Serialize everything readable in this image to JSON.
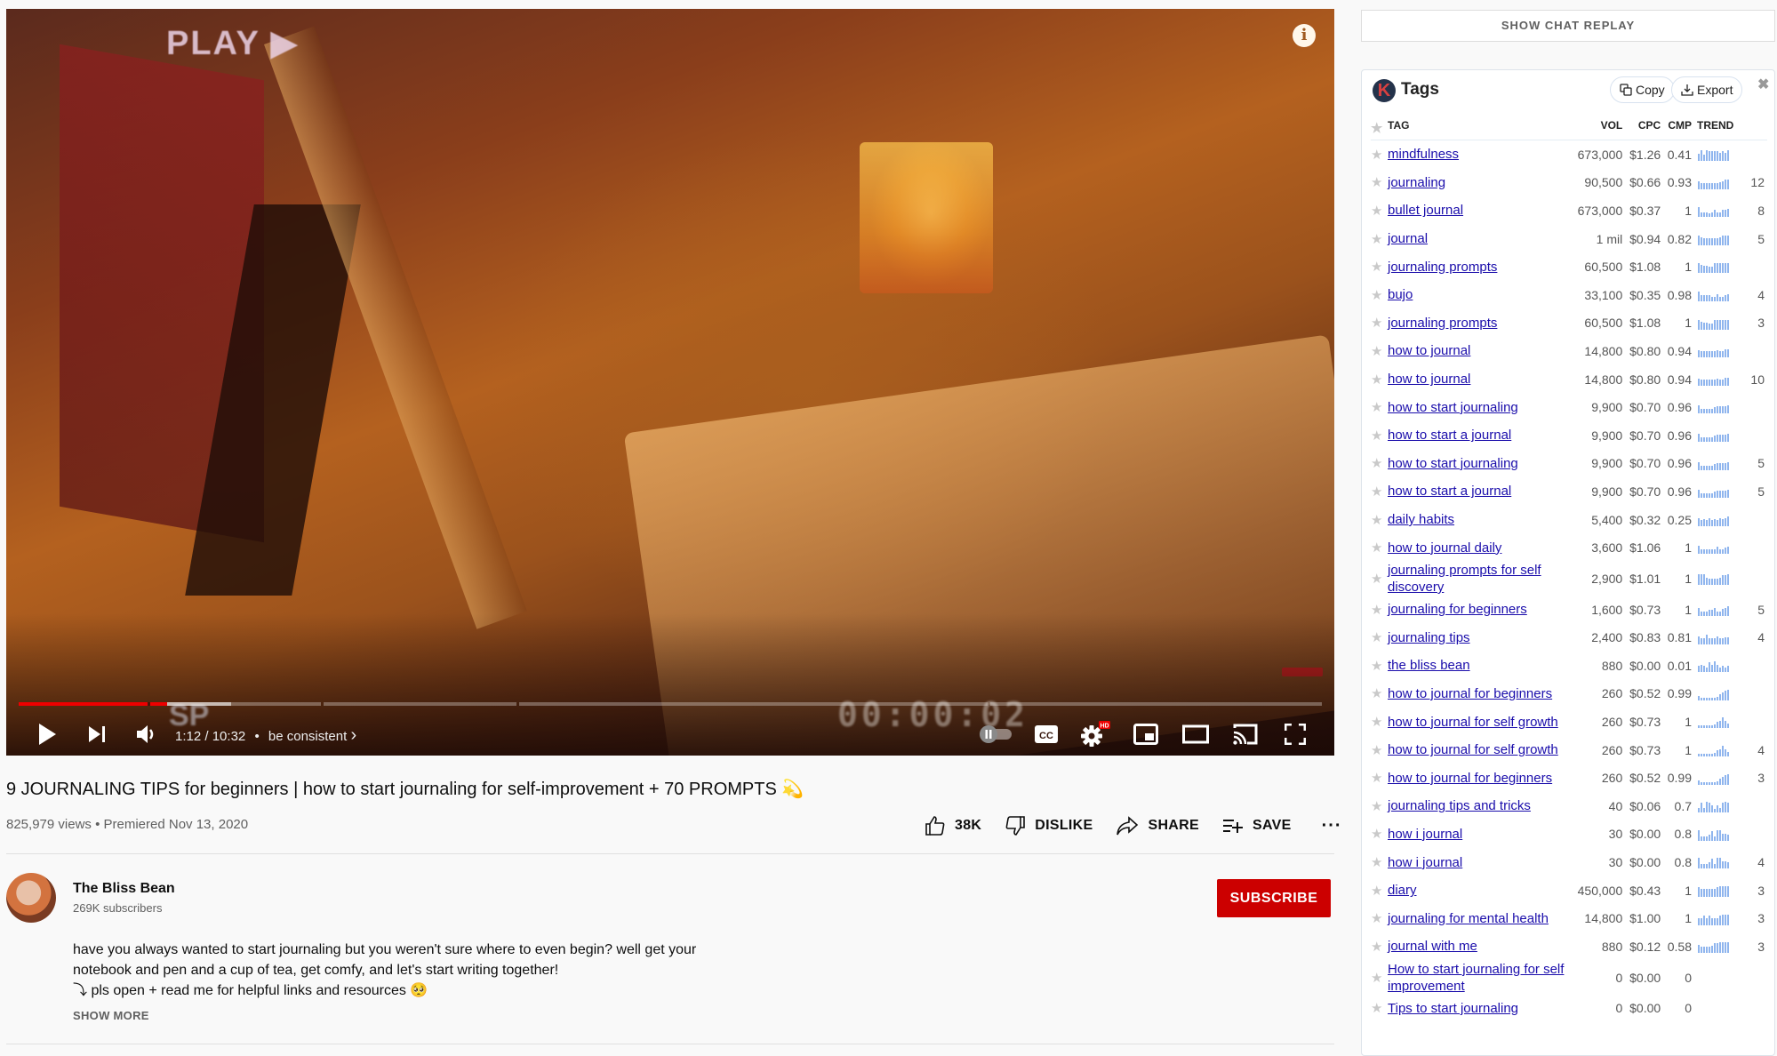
{
  "video": {
    "overlay_text": "PLAY ▶",
    "timecode_overlay": "00:00:02",
    "sp_overlay": "SP",
    "info_icon": "info-icon",
    "progress": {
      "played_fraction": 0.114,
      "loaded_fraction": 0.163
    },
    "current_time": "1:12",
    "duration": "10:32",
    "time_separator": "/",
    "chapter_dot": "•",
    "chapter": "be consistent",
    "chapter_chevron": "›",
    "settings_badge": "HD",
    "cc_label": "CC",
    "icons": [
      "play-icon",
      "next-icon",
      "volume-icon",
      "autoplay-toggle",
      "cc-icon",
      "settings-icon",
      "miniplayer-icon",
      "theater-icon",
      "cast-icon",
      "fullscreen-icon"
    ]
  },
  "title": "9 JOURNALING TIPS for beginners | how to start journaling for self-improvement + 70 PROMPTS 💫",
  "views": "825,979 views",
  "meta_dot": "•",
  "premiered": "Premiered Nov 13, 2020",
  "actions": {
    "like": "38K",
    "dislike": "DISLIKE",
    "share": "SHARE",
    "save": "SAVE",
    "more": "···"
  },
  "channel": {
    "name": "The Bliss Bean",
    "subscribers": "269K subscribers",
    "subscribe": "SUBSCRIBE"
  },
  "description": {
    "line1": "have you always wanted to start journaling but you weren't sure where to even begin? well get your notebook and pen and a cup of tea, get comfy, and let's start writing together!",
    "line2": "⤵ pls open + read me for helpful links and resources 🥺",
    "show_more": "SHOW MORE"
  },
  "chat_replay": "SHOW CHAT REPLAY",
  "tags_panel": {
    "logo": "K",
    "title": "Tags",
    "copy": "Copy",
    "export": "Export",
    "close": "✖",
    "columns": {
      "star": "★",
      "tag": "TAG",
      "vol": "VOL",
      "cpc": "CPC",
      "cmp": "CMP",
      "trend": "TREND"
    },
    "rows": [
      {
        "tag": "mindfulness",
        "vol": "673,000",
        "cpc": "$1.26",
        "cmp": "0.41",
        "trend": [
          6,
          9,
          5,
          9,
          8,
          8,
          8,
          8,
          7,
          8,
          7,
          9
        ],
        "extra": ""
      },
      {
        "tag": "journaling",
        "vol": "90,500",
        "cpc": "$0.66",
        "cmp": "0.93",
        "trend": [
          7,
          5,
          5,
          5,
          5,
          5,
          5,
          5,
          6,
          7,
          8,
          8
        ],
        "extra": "12"
      },
      {
        "tag": "bullet journal",
        "vol": "673,000",
        "cpc": "$0.37",
        "cmp": "1",
        "trend": [
          8,
          4,
          4,
          4,
          3,
          4,
          6,
          4,
          4,
          6,
          6,
          7
        ],
        "extra": "8"
      },
      {
        "tag": "journal",
        "vol": "1 mil",
        "cpc": "$0.94",
        "cmp": "0.82",
        "trend": [
          8,
          7,
          6,
          6,
          6,
          6,
          6,
          6,
          7,
          8,
          8,
          8
        ],
        "extra": "5"
      },
      {
        "tag": "journaling prompts",
        "vol": "60,500",
        "cpc": "$1.08",
        "cmp": "1",
        "trend": [
          8,
          7,
          6,
          6,
          5,
          5,
          8,
          8,
          8,
          8,
          8,
          8
        ],
        "extra": ""
      },
      {
        "tag": "bujo",
        "vol": "33,100",
        "cpc": "$0.35",
        "cmp": "0.98",
        "trend": [
          8,
          5,
          5,
          5,
          5,
          4,
          4,
          6,
          4,
          4,
          5,
          6
        ],
        "extra": "4"
      },
      {
        "tag": "journaling prompts",
        "vol": "60,500",
        "cpc": "$1.08",
        "cmp": "1",
        "trend": [
          8,
          7,
          6,
          6,
          5,
          5,
          8,
          8,
          8,
          8,
          8,
          8
        ],
        "extra": "3"
      },
      {
        "tag": "how to journal",
        "vol": "14,800",
        "cpc": "$0.80",
        "cmp": "0.94",
        "trend": [
          6,
          5,
          5,
          5,
          5,
          5,
          5,
          6,
          5,
          5,
          7,
          7
        ],
        "extra": ""
      },
      {
        "tag": "how to journal",
        "vol": "14,800",
        "cpc": "$0.80",
        "cmp": "0.94",
        "trend": [
          6,
          5,
          5,
          5,
          5,
          5,
          5,
          6,
          5,
          5,
          7,
          7
        ],
        "extra": "10"
      },
      {
        "tag": "how to start journaling",
        "vol": "9,900",
        "cpc": "$0.70",
        "cmp": "0.96",
        "trend": [
          7,
          4,
          4,
          4,
          4,
          4,
          5,
          6,
          6,
          6,
          6,
          7
        ],
        "extra": ""
      },
      {
        "tag": "how to start a journal",
        "vol": "9,900",
        "cpc": "$0.70",
        "cmp": "0.96",
        "trend": [
          7,
          4,
          4,
          4,
          4,
          4,
          5,
          6,
          6,
          6,
          6,
          7
        ],
        "extra": ""
      },
      {
        "tag": "how to start journaling",
        "vol": "9,900",
        "cpc": "$0.70",
        "cmp": "0.96",
        "trend": [
          7,
          4,
          4,
          4,
          4,
          4,
          5,
          6,
          6,
          6,
          6,
          7
        ],
        "extra": "5"
      },
      {
        "tag": "how to start a journal",
        "vol": "9,900",
        "cpc": "$0.70",
        "cmp": "0.96",
        "trend": [
          7,
          4,
          4,
          4,
          4,
          4,
          5,
          6,
          6,
          6,
          6,
          7
        ],
        "extra": "5"
      },
      {
        "tag": "daily habits",
        "vol": "5,400",
        "cpc": "$0.32",
        "cmp": "0.25",
        "trend": [
          7,
          5,
          6,
          5,
          7,
          5,
          6,
          5,
          7,
          6,
          7,
          8
        ],
        "extra": ""
      },
      {
        "tag": "how to journal daily",
        "vol": "3,600",
        "cpc": "$1.06",
        "cmp": "1",
        "trend": [
          7,
          4,
          4,
          4,
          4,
          4,
          4,
          6,
          4,
          4,
          5,
          6
        ],
        "extra": ""
      },
      {
        "tag": "journaling prompts for self discovery",
        "vol": "2,900",
        "cpc": "$1.01",
        "cmp": "1",
        "trend": [
          9,
          9,
          9,
          6,
          5,
          5,
          5,
          5,
          6,
          8,
          8,
          9
        ],
        "extra": ""
      },
      {
        "tag": "journaling for beginners",
        "vol": "1,600",
        "cpc": "$0.73",
        "cmp": "1",
        "trend": [
          7,
          4,
          4,
          4,
          5,
          5,
          7,
          4,
          4,
          6,
          7,
          8
        ],
        "extra": "5"
      },
      {
        "tag": "journaling tips",
        "vol": "2,400",
        "cpc": "$0.83",
        "cmp": "0.81",
        "trend": [
          7,
          5,
          5,
          8,
          5,
          5,
          5,
          7,
          5,
          5,
          6,
          6
        ],
        "extra": "4"
      },
      {
        "tag": "the bliss bean",
        "vol": "880",
        "cpc": "$0.00",
        "cmp": "0.01",
        "trend": [
          5,
          6,
          5,
          4,
          8,
          6,
          9,
          6,
          4,
          5,
          4,
          5
        ],
        "extra": ""
      },
      {
        "tag": "how to journal for beginners",
        "vol": "260",
        "cpc": "$0.52",
        "cmp": "0.99",
        "trend": [
          4,
          2,
          2,
          2,
          2,
          2,
          2,
          3,
          5,
          7,
          8,
          9
        ],
        "extra": ""
      },
      {
        "tag": "how to journal for self growth",
        "vol": "260",
        "cpc": "$0.73",
        "cmp": "1",
        "trend": [
          2,
          2,
          2,
          2,
          2,
          2,
          3,
          5,
          6,
          9,
          6,
          4
        ],
        "extra": ""
      },
      {
        "tag": "how to journal for self growth",
        "vol": "260",
        "cpc": "$0.73",
        "cmp": "1",
        "trend": [
          2,
          2,
          2,
          2,
          2,
          2,
          3,
          5,
          6,
          9,
          6,
          4
        ],
        "extra": "4"
      },
      {
        "tag": "how to journal for beginners",
        "vol": "260",
        "cpc": "$0.52",
        "cmp": "0.99",
        "trend": [
          4,
          2,
          2,
          2,
          2,
          2,
          2,
          3,
          5,
          7,
          8,
          9
        ],
        "extra": "3"
      },
      {
        "tag": "journaling tips and tricks",
        "vol": "40",
        "cpc": "$0.06",
        "cmp": "0.7",
        "trend": [
          4,
          8,
          4,
          9,
          8,
          6,
          3,
          6,
          4,
          8,
          9,
          8
        ],
        "extra": ""
      },
      {
        "tag": "how i journal",
        "vol": "30",
        "cpc": "$0.00",
        "cmp": "0.8",
        "trend": [
          9,
          4,
          4,
          4,
          5,
          8,
          4,
          9,
          9,
          6,
          6,
          5
        ],
        "extra": ""
      },
      {
        "tag": "how i journal",
        "vol": "30",
        "cpc": "$0.00",
        "cmp": "0.8",
        "trend": [
          9,
          4,
          4,
          4,
          5,
          8,
          4,
          9,
          9,
          6,
          6,
          5
        ],
        "extra": "4"
      },
      {
        "tag": "diary",
        "vol": "450,000",
        "cpc": "$0.43",
        "cmp": "1",
        "trend": [
          8,
          7,
          7,
          7,
          7,
          7,
          7,
          8,
          9,
          9,
          9,
          9
        ],
        "extra": "3"
      },
      {
        "tag": "journaling for mental health",
        "vol": "14,800",
        "cpc": "$1.00",
        "cmp": "1",
        "trend": [
          6,
          6,
          8,
          6,
          8,
          6,
          6,
          6,
          8,
          9,
          9,
          9
        ],
        "extra": "3"
      },
      {
        "tag": "journal with me",
        "vol": "880",
        "cpc": "$0.12",
        "cmp": "0.58",
        "trend": [
          7,
          5,
          5,
          5,
          5,
          6,
          8,
          8,
          9,
          9,
          9,
          9
        ],
        "extra": "3"
      },
      {
        "tag": "How to start journaling for self improvement",
        "vol": "0",
        "cpc": "$0.00",
        "cmp": "0",
        "trend": [],
        "extra": ""
      },
      {
        "tag": "Tips to start journaling",
        "vol": "0",
        "cpc": "$0.00",
        "cmp": "0",
        "trend": [],
        "extra": ""
      }
    ]
  },
  "colors": {
    "accent_red": "#cc0000",
    "progress_red": "#ee0000",
    "link": "#1a0dab",
    "sparkline": "#8fb5ee"
  }
}
